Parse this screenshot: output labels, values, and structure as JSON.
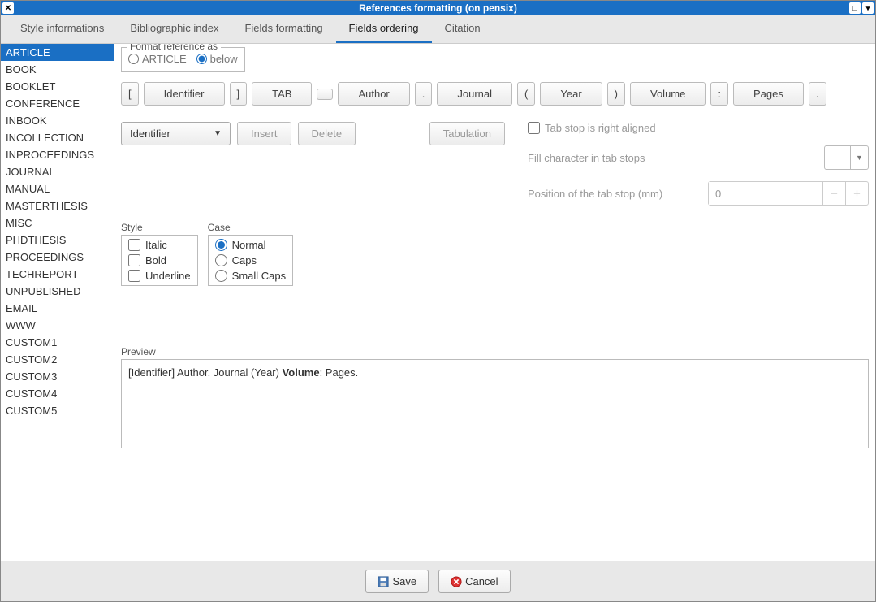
{
  "window": {
    "title": "References formatting (on pensix)"
  },
  "tabs": [
    {
      "label": "Style informations"
    },
    {
      "label": "Bibliographic index"
    },
    {
      "label": "Fields formatting"
    },
    {
      "label": "Fields ordering",
      "active": true
    },
    {
      "label": "Citation"
    }
  ],
  "sidebar": {
    "items": [
      "ARTICLE",
      "BOOK",
      "BOOKLET",
      "CONFERENCE",
      "INBOOK",
      "INCOLLECTION",
      "INPROCEEDINGS",
      "JOURNAL",
      "MANUAL",
      "MASTERTHESIS",
      "MISC",
      "PHDTHESIS",
      "PROCEEDINGS",
      "TECHREPORT",
      "UNPUBLISHED",
      "EMAIL",
      "WWW",
      "CUSTOM1",
      "CUSTOM2",
      "CUSTOM3",
      "CUSTOM4",
      "CUSTOM5"
    ],
    "selected": 0
  },
  "format_as": {
    "legend": "Format reference as",
    "opt1": "ARTICLE",
    "opt2": "below",
    "selected": "below"
  },
  "tokens": [
    "[",
    "Identifier",
    "]",
    "TAB",
    "",
    "Author",
    ".",
    "Journal",
    "(",
    "Year",
    ")",
    "Volume",
    ":",
    "Pages",
    "."
  ],
  "identifier_combo": "Identifier",
  "buttons": {
    "insert": "Insert",
    "delete": "Delete",
    "tabulation": "Tabulation"
  },
  "taboptions": {
    "right_aligned": "Tab stop is right aligned",
    "fill_char": "Fill character in tab stops",
    "position": "Position of the tab stop (mm)",
    "position_value": "0"
  },
  "style_group": {
    "label": "Style",
    "italic": "Italic",
    "bold": "Bold",
    "underline": "Underline"
  },
  "case_group": {
    "label": "Case",
    "normal": "Normal",
    "caps": "Caps",
    "small": "Small Caps"
  },
  "preview": {
    "label": "Preview",
    "p1": "[Identifier]    Author. Journal (Year) ",
    "p2": "Volume",
    "p3": ": Pages."
  },
  "footer": {
    "save": "Save",
    "cancel": "Cancel"
  }
}
